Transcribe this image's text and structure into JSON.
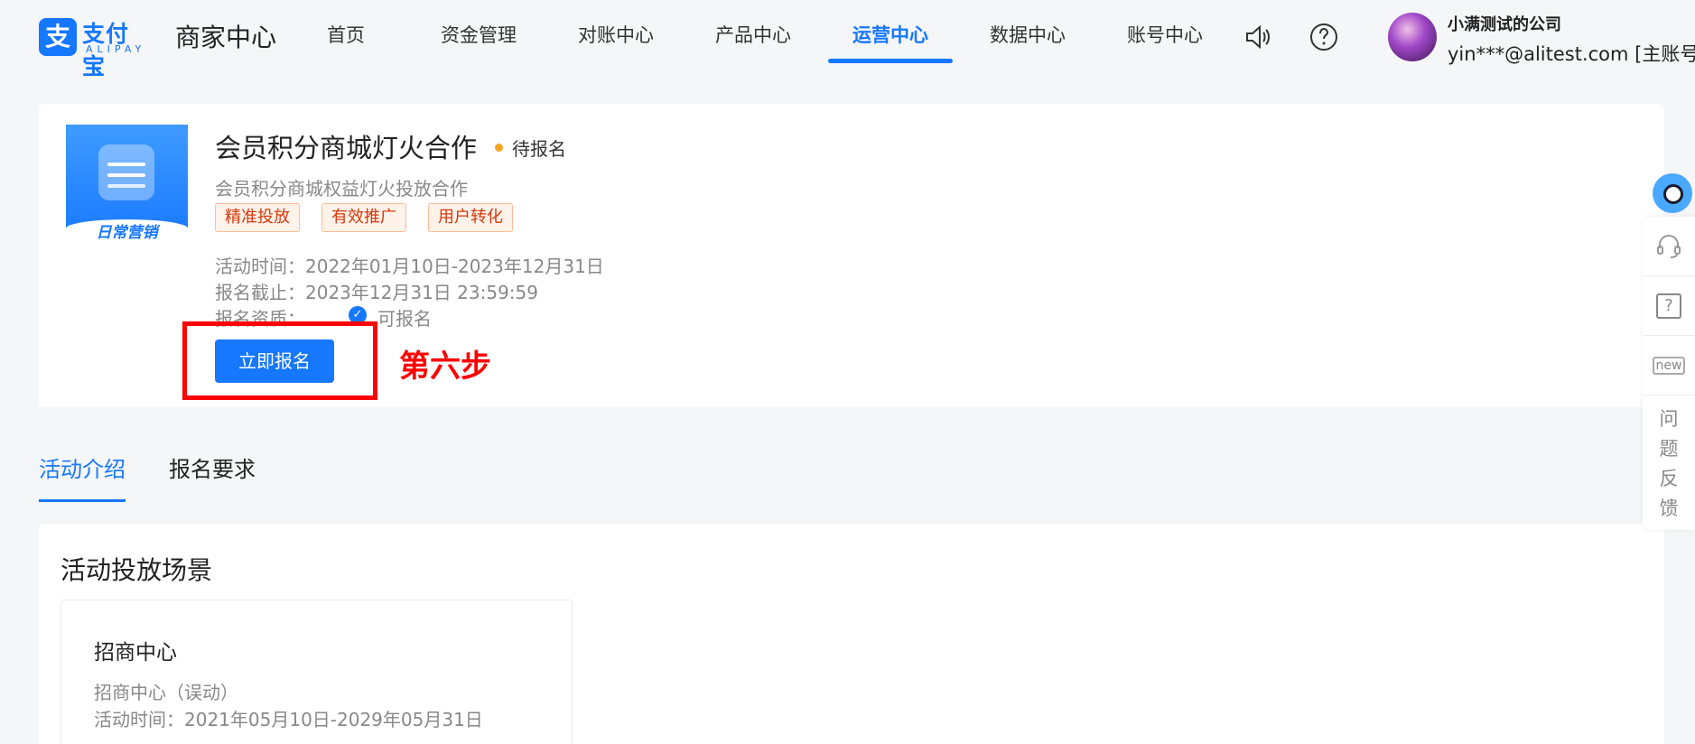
{
  "header": {
    "logo_cn": "支付宝",
    "logo_en": "ALIPAY",
    "site_name": "商家中心",
    "nav": [
      {
        "label": "首页"
      },
      {
        "label": "资金管理"
      },
      {
        "label": "对账中心"
      },
      {
        "label": "产品中心"
      },
      {
        "label": "运营中心",
        "active": true
      },
      {
        "label": "数据中心"
      },
      {
        "label": "账号中心"
      }
    ],
    "icons": [
      "speaker-icon",
      "help-icon"
    ],
    "user": {
      "company": "小满测试的公司",
      "account": "yin***@alitest.com [主账号]"
    }
  },
  "activity": {
    "thumb_caption": "日常营销",
    "title": "会员积分商城灯火合作",
    "status": "待报名",
    "subtitle": "会员积分商城权益灯火投放合作",
    "tags": [
      "精准投放",
      "有效推广",
      "用户转化"
    ],
    "time_label": "活动时间：",
    "time_value": "2022年01月10日-2023年12月31日",
    "deadline_label": "报名截止：",
    "deadline_value": "2023年12月31日 23:59:59",
    "qualification_label": "报名资质：",
    "qualification_value": "可报名",
    "signup_button": "立即报名",
    "annotation": "第六步"
  },
  "tabs": [
    {
      "label": "活动介绍",
      "active": true
    },
    {
      "label": "报名要求",
      "active": false
    }
  ],
  "scenes": {
    "section_title": "活动投放场景",
    "items": [
      {
        "name": "招商中心",
        "desc": "招商中心（误动）",
        "time": "活动时间：2021年05月10日-2029年05月31日"
      }
    ]
  },
  "float_panel": {
    "feedback_chars": [
      "问",
      "题",
      "反",
      "馈"
    ]
  },
  "colors": {
    "brand": "#1677ff",
    "tag_text": "#d4380d",
    "annotation": "#ff0000"
  }
}
